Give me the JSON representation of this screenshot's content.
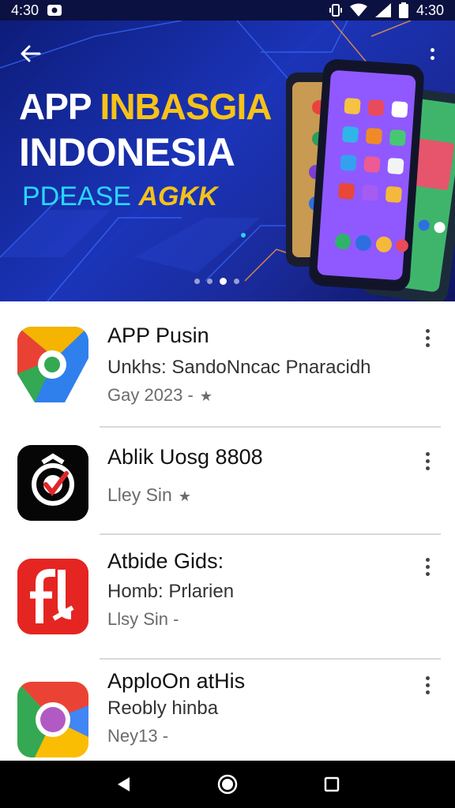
{
  "status_bar": {
    "time_left": "4:30",
    "time_right": "4:30",
    "icons": [
      "notification-icon",
      "vibrate-icon",
      "wifi-icon",
      "signal-icon",
      "battery-icon"
    ]
  },
  "hero": {
    "title_part1": "APP",
    "title_part2": "INBASGIA",
    "title_line2": "INDONESIA",
    "subtitle_part1": "PDEASE",
    "subtitle_part2": "AGKK",
    "carousel_pages": 4,
    "carousel_active": 3,
    "colors": {
      "background": "#1b34b8",
      "accent": "#f6c21a",
      "subtitle": "#28d7ff"
    }
  },
  "apps": [
    {
      "name": "APP Pusin",
      "line2": "Unkhs: SandoNncac Pnaracidh",
      "line3": "Gay 2023 -",
      "has_star": true,
      "icon": "maps-style-icon"
    },
    {
      "name": "Ablik Uosg 8808",
      "line2": "Lley Sin",
      "line3": "",
      "has_star": true,
      "icon": "camera-check-icon"
    },
    {
      "name": "Atbide Gids:",
      "line2": "Homb: Prlarien",
      "line3": "Llsy Sin -",
      "has_star": false,
      "icon": "red-f-icon"
    },
    {
      "name": "ApploOn atHis",
      "line2": "Reobly hinba",
      "line3": "Ney13 -",
      "has_star": false,
      "icon": "chrome-style-icon"
    }
  ],
  "nav": {
    "icons": [
      "back-triangle-icon",
      "home-circle-icon",
      "recents-square-icon"
    ]
  }
}
